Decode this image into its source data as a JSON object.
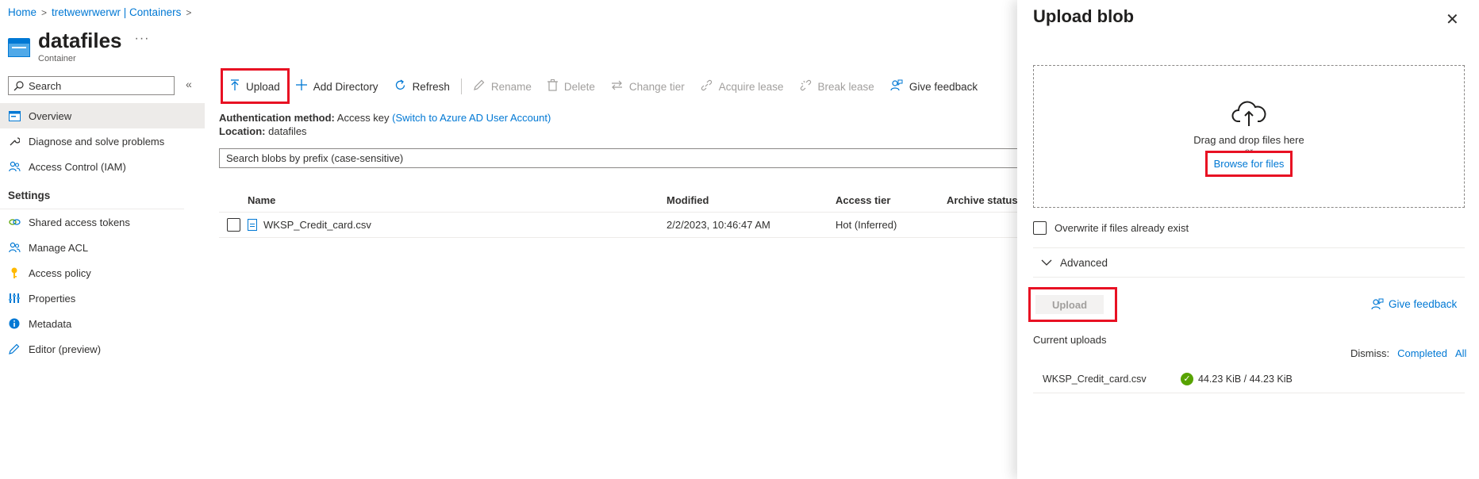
{
  "breadcrumb": {
    "items": [
      "Home",
      "tretwewrwerwr | Containers"
    ],
    "separator": ">"
  },
  "header": {
    "title": "datafiles",
    "subtitle": "Container",
    "more": "···"
  },
  "sidebar": {
    "search_placeholder": "Search",
    "collapse": "«",
    "items": [
      {
        "label": "Overview",
        "icon": "overview-icon",
        "active": true
      },
      {
        "label": "Diagnose and solve problems",
        "icon": "wrench-icon"
      },
      {
        "label": "Access Control (IAM)",
        "icon": "people-icon"
      }
    ],
    "settings_label": "Settings",
    "settings_items": [
      {
        "label": "Shared access tokens",
        "icon": "link-icon"
      },
      {
        "label": "Manage ACL",
        "icon": "people-icon"
      },
      {
        "label": "Access policy",
        "icon": "key-icon"
      },
      {
        "label": "Properties",
        "icon": "properties-icon"
      },
      {
        "label": "Metadata",
        "icon": "info-icon"
      },
      {
        "label": "Editor (preview)",
        "icon": "pencil-icon"
      }
    ]
  },
  "toolbar": {
    "upload": "Upload",
    "add_directory": "Add Directory",
    "refresh": "Refresh",
    "rename": "Rename",
    "delete": "Delete",
    "change_tier": "Change tier",
    "acquire_lease": "Acquire lease",
    "break_lease": "Break lease",
    "give_feedback": "Give feedback"
  },
  "info": {
    "auth_label": "Authentication method:",
    "auth_value": "Access key",
    "auth_link": "(Switch to Azure AD User Account)",
    "location_label": "Location:",
    "location_value": "datafiles"
  },
  "blob_search": {
    "placeholder": "Search blobs by prefix (case-sensitive)"
  },
  "table": {
    "headers": [
      "Name",
      "Modified",
      "Access tier",
      "Archive status"
    ],
    "rows": [
      {
        "name": "WKSP_Credit_card.csv",
        "modified": "2/2/2023, 10:46:47 AM",
        "tier": "Hot (Inferred)",
        "archive": ""
      }
    ]
  },
  "panel": {
    "title": "Upload blob",
    "close": "✕",
    "drop_text": "Drag and drop files here",
    "or_text": "or",
    "browse": "Browse for files",
    "overwrite": "Overwrite if files already exist",
    "advanced": "Advanced",
    "upload_button": "Upload",
    "give_feedback": "Give feedback",
    "current_uploads": "Current uploads",
    "dismiss_label": "Dismiss:",
    "dismiss_completed": "Completed",
    "dismiss_all": "All",
    "upload_file": "WKSP_Credit_card.csv",
    "upload_progress": "44.23 KiB / 44.23 KiB"
  },
  "colors": {
    "accent": "#0078d4",
    "highlight": "#e81123",
    "success": "#57a300"
  }
}
